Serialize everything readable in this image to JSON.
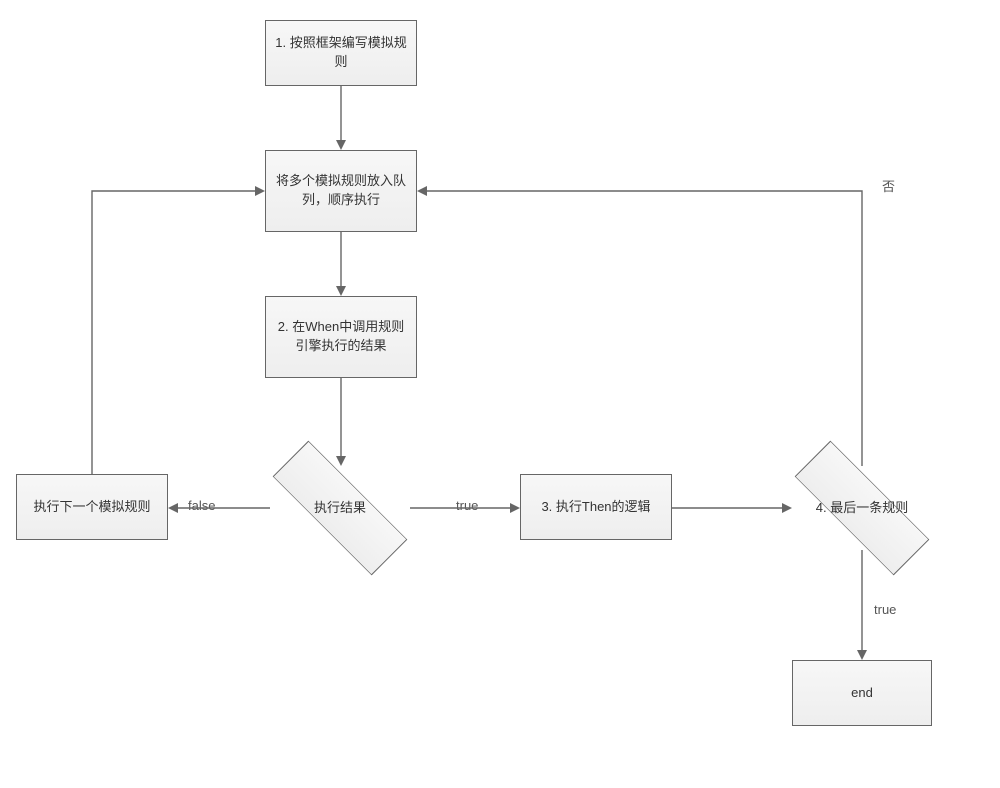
{
  "nodes": {
    "n1": "1. 按照框架编写模拟规则",
    "queue": "将多个模拟规则放入队列，顺序执行",
    "n2": "2. 在When中调用规则引擎执行的结果",
    "result": "执行结果",
    "next": "执行下一个模拟规则",
    "n3": "3. 执行Then的逻辑",
    "n4": "4. 最后一条规则",
    "end": "end"
  },
  "edges": {
    "false_label": "false",
    "true_label": "true",
    "no_label": "否",
    "true_label2": "true"
  }
}
